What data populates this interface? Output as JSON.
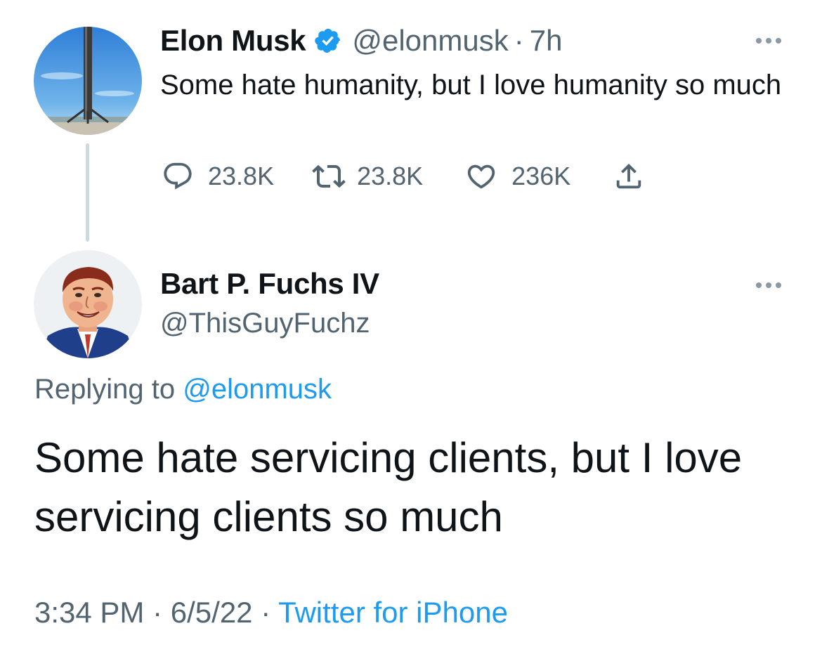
{
  "parent_tweet": {
    "author_name": "Elon Musk",
    "handle": "@elonmusk",
    "separator": "·",
    "time_ago": "7h",
    "text": "Some hate humanity, but I love humanity so much",
    "replies": "23.8K",
    "retweets": "23.8K",
    "likes": "236K"
  },
  "reply_tweet": {
    "author_name": "Bart P. Fuchs IV",
    "handle": "@ThisGuyFuchz",
    "replying_prefix": "Replying to",
    "replying_to": "@elonmusk",
    "text": "Some hate servicing clients, but I love servicing clients so much",
    "time": "3:34 PM",
    "date": "6/5/22",
    "separator": "·",
    "source": "Twitter for iPhone"
  },
  "colors": {
    "link": "#1d9bf0",
    "muted": "#536471",
    "text": "#0f1419",
    "thread_line": "#cfd9de"
  },
  "icons": [
    "verified-badge-icon",
    "more-icon",
    "reply-icon",
    "retweet-icon",
    "like-icon",
    "share-icon"
  ]
}
